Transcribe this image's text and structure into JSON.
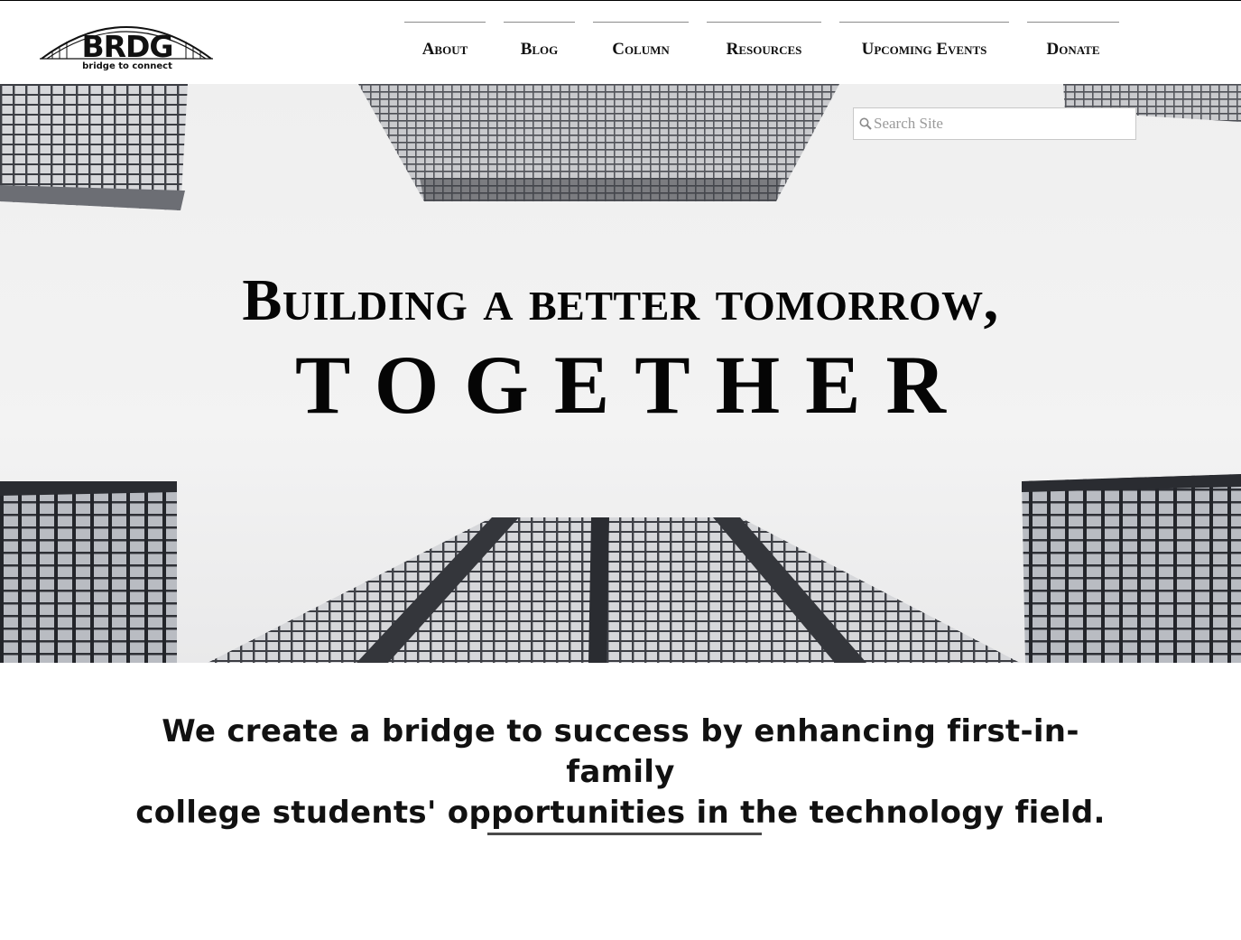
{
  "logo": {
    "name": "BRDG",
    "tagline": "bridge to connect"
  },
  "nav": {
    "items": [
      {
        "label": "About"
      },
      {
        "label": "Blog"
      },
      {
        "label": "Column"
      },
      {
        "label": "Resources"
      },
      {
        "label": "Upcoming Events"
      },
      {
        "label": "Donate"
      }
    ]
  },
  "search": {
    "placeholder": "Search Site",
    "icon": "search-icon"
  },
  "hero": {
    "headline": "Building a better tomorrow,",
    "headline_emphasis": "TOGETHER"
  },
  "mission": {
    "line1": "We create a bridge to success by enhancing first-in-family",
    "line2": "college students' opportunities in the technology field."
  },
  "colors": {
    "text": "#050505",
    "accent_line": "#4a4a4a",
    "background": "#ffffff"
  }
}
